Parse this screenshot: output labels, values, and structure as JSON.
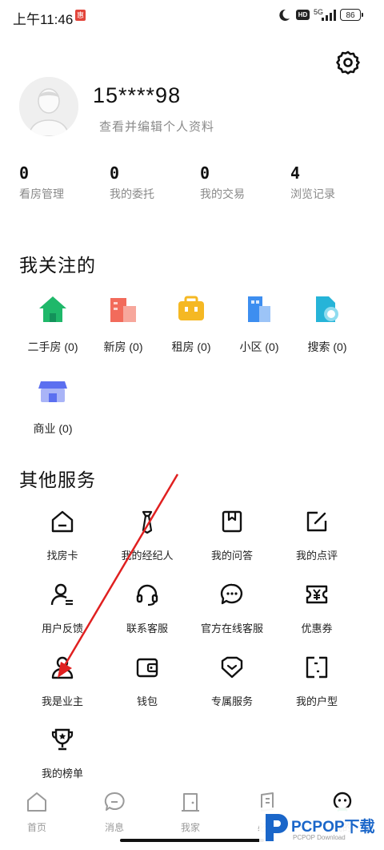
{
  "status_bar": {
    "time": "上午11:46",
    "sim_badge": "惠",
    "hd": "HD",
    "network": "5G",
    "battery": "86"
  },
  "profile": {
    "username": "15****98",
    "edit_text": "查看并编辑个人资料"
  },
  "stats": [
    {
      "value": "0",
      "label": "看房管理"
    },
    {
      "value": "0",
      "label": "我的委托"
    },
    {
      "value": "0",
      "label": "我的交易"
    },
    {
      "value": "4",
      "label": "浏览记录"
    }
  ],
  "favorites": {
    "title": "我关注的",
    "items": [
      {
        "label": "二手房 (0)",
        "icon": "house-icon",
        "color": "#1fb86a"
      },
      {
        "label": "新房 (0)",
        "icon": "building-icon",
        "color": "#f26b5b"
      },
      {
        "label": "租房 (0)",
        "icon": "briefcase-icon",
        "color": "#f5b823"
      },
      {
        "label": "小区 (0)",
        "icon": "community-icon",
        "color": "#3d8ef0"
      },
      {
        "label": "搜索 (0)",
        "icon": "search-icon",
        "color": "#26b4d8"
      },
      {
        "label": "商业 (0)",
        "icon": "shop-icon",
        "color": "#5b6ff0"
      }
    ]
  },
  "services": {
    "title": "其他服务",
    "items": [
      {
        "label": "找房卡",
        "icon": "house-card-icon"
      },
      {
        "label": "我的经纪人",
        "icon": "agent-icon"
      },
      {
        "label": "我的问答",
        "icon": "qa-icon"
      },
      {
        "label": "我的点评",
        "icon": "review-icon"
      },
      {
        "label": "用户反馈",
        "icon": "feedback-icon"
      },
      {
        "label": "联系客服",
        "icon": "headset-icon"
      },
      {
        "label": "官方在线客服",
        "icon": "chat-icon"
      },
      {
        "label": "优惠券",
        "icon": "coupon-icon"
      },
      {
        "label": "我是业主",
        "icon": "owner-icon"
      },
      {
        "label": "钱包",
        "icon": "wallet-icon"
      },
      {
        "label": "专属服务",
        "icon": "exclusive-service-icon"
      },
      {
        "label": "我的户型",
        "icon": "floorplan-icon"
      },
      {
        "label": "我的榜单",
        "icon": "trophy-icon"
      }
    ]
  },
  "bottom_nav": [
    {
      "label": "首页",
      "icon": "home-tab-icon"
    },
    {
      "label": "消息",
      "icon": "message-tab-icon"
    },
    {
      "label": "我家",
      "icon": "myhome-tab-icon"
    },
    {
      "label": "必看",
      "icon": "must-see-tab-icon"
    },
    {
      "label": "我的",
      "icon": "profile-tab-icon"
    }
  ],
  "watermark": {
    "brand": "PCPOP下载",
    "sub": "PCPOP Download"
  },
  "annotation": {
    "color": "#e02020"
  }
}
